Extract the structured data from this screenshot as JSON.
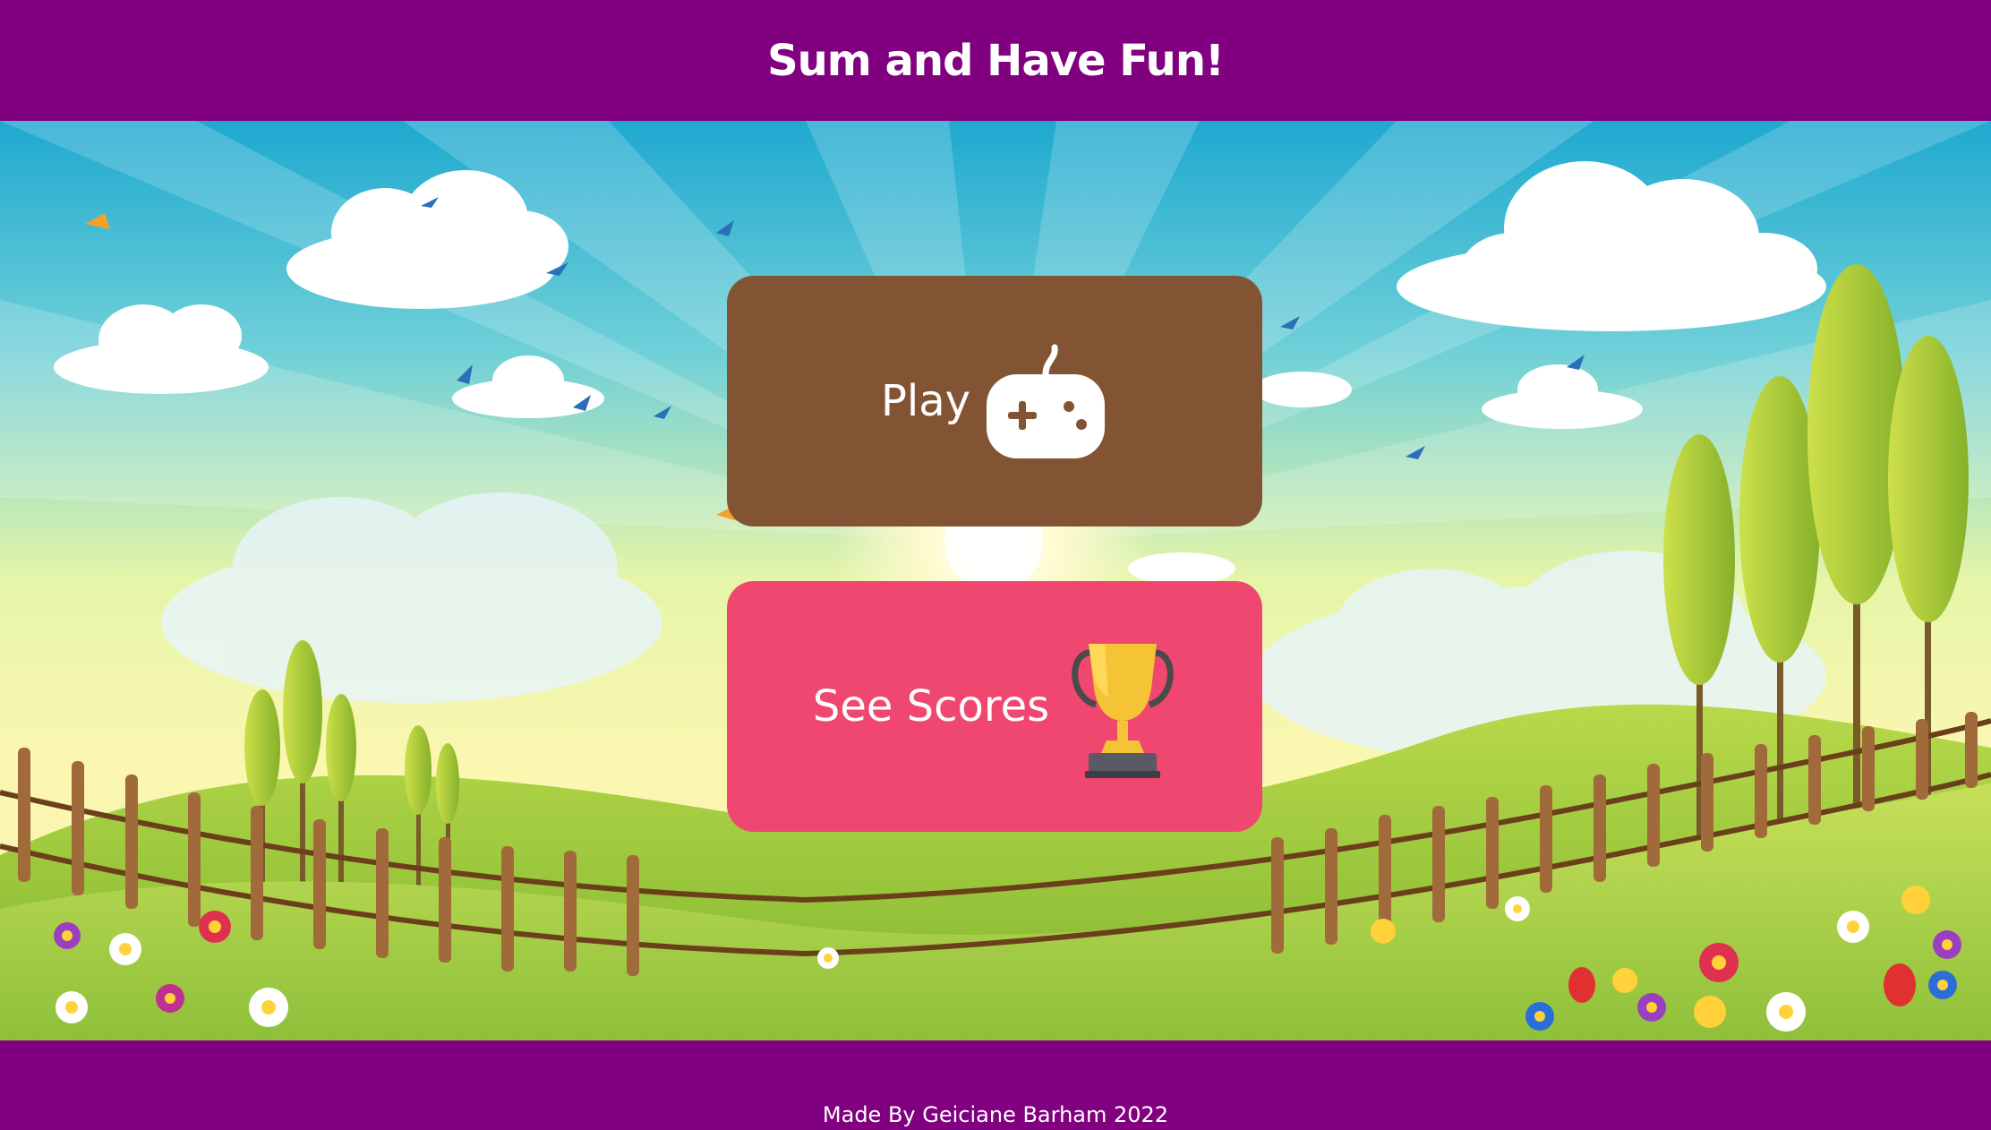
{
  "header": {
    "title": "Sum and Have Fun!"
  },
  "menu": {
    "play_label": "Play",
    "play_icon": "gamepad-icon",
    "scores_label": "See Scores",
    "scores_icon": "trophy-icon"
  },
  "footer": {
    "credit": "Made By Geiciane Barham 2022"
  },
  "colors": {
    "header_bg": "#800080",
    "play_button": "#825433",
    "scores_button": "#ef476f",
    "text": "#ffffff"
  }
}
